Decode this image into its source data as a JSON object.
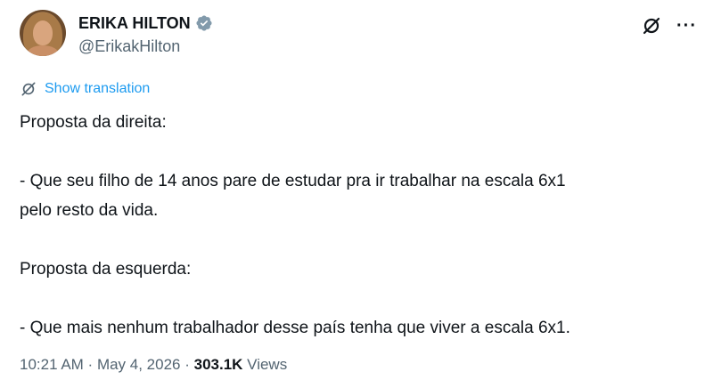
{
  "author": {
    "display_name": "ERIKA HILTON",
    "handle": "@ErikakHilton",
    "verified_color": "#829aab"
  },
  "actions": {
    "grok_icon": "grok-icon",
    "more_label": "···"
  },
  "translate": {
    "label": "Show translation"
  },
  "tweet": {
    "lines": [
      "Proposta da direita:",
      "- Que seu filho de 14 anos pare de estudar pra ir trabalhar na escala 6x1",
      "pelo resto da vida.",
      "Proposta da esquerda:",
      "- Que mais nenhum trabalhador desse país tenha que viver a escala 6x1."
    ]
  },
  "meta": {
    "time": "10:21 AM",
    "separator": " · ",
    "date": "May 4, 2026",
    "views_count": "303.1K",
    "views_label": " Views"
  },
  "colors": {
    "link": "#1d9bf0",
    "secondary": "#536471",
    "text": "#0f1419"
  }
}
